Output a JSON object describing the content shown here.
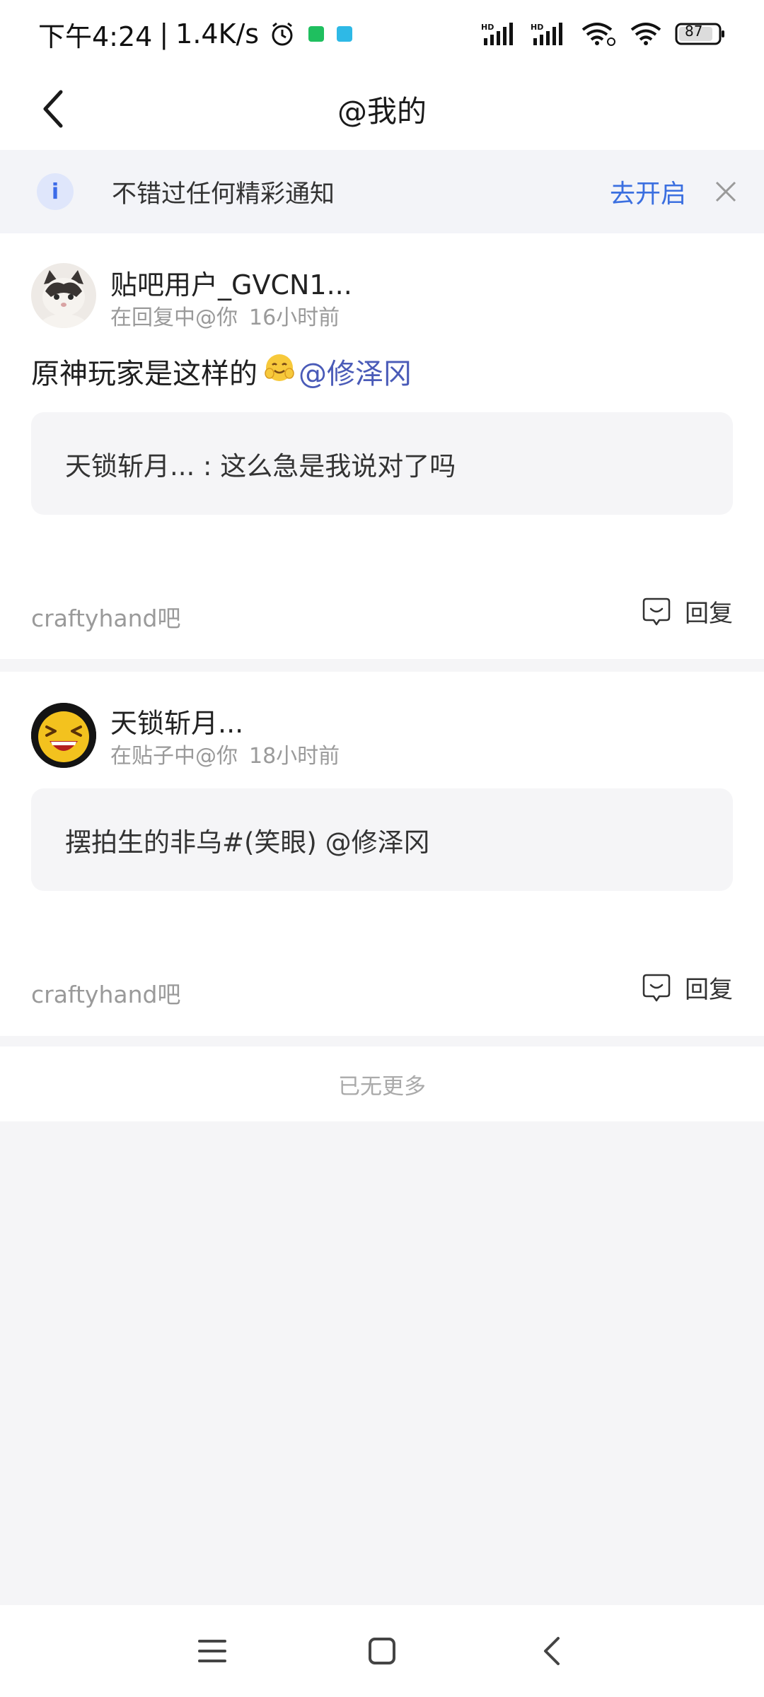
{
  "status_bar": {
    "time": "下午4:24",
    "speed": "1.4K/s",
    "battery": "87",
    "app_icon_colors": [
      "#1fbf5f",
      "#2eb9e6"
    ]
  },
  "header": {
    "title": "@我的"
  },
  "notice": {
    "text": "不错过任何精彩通知",
    "action": "去开启"
  },
  "items": [
    {
      "author": "贴吧用户_GVCN1...",
      "context": "在回复中@你",
      "time": "16小时前",
      "content": "原神玩家是这样的",
      "mention": "@修泽冈",
      "quote": "天锁斩月... : 这么急是我说对了吗",
      "forum": "craftyhand吧",
      "reply_label": "回复"
    },
    {
      "author": "天锁斩月...",
      "context": "在贴子中@你",
      "time": "18小时前",
      "quote": "摆拍生的非乌#(笑眼) @修泽冈",
      "forum": "craftyhand吧",
      "reply_label": "回复"
    }
  ],
  "end_text": "已无更多",
  "accent_color": "#3b6fe0"
}
